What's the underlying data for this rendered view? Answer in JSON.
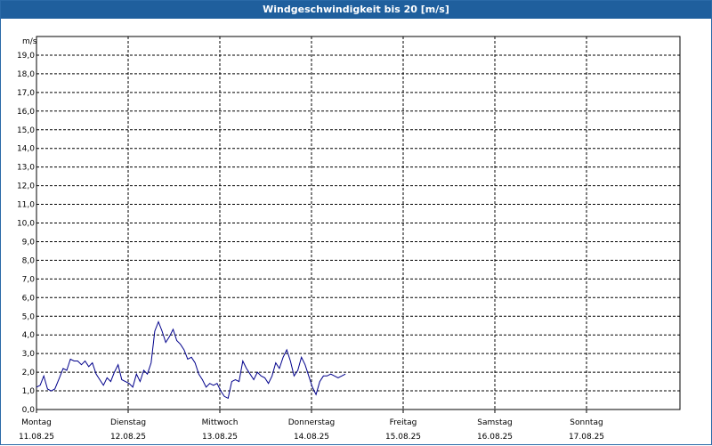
{
  "title": "Windgeschwindigkeit bis 20 [m/s]",
  "chart_data": {
    "type": "line",
    "title": "Windgeschwindigkeit bis 20 [m/s]",
    "ylabel": "m/s",
    "ylim": [
      0,
      20
    ],
    "y_ticks": [
      "0,0",
      "1,0",
      "2,0",
      "3,0",
      "4,0",
      "5,0",
      "6,0",
      "7,0",
      "8,0",
      "9,0",
      "10,0",
      "11,0",
      "12,0",
      "13,0",
      "14,0",
      "15,0",
      "16,0",
      "17,0",
      "18,0",
      "19,0"
    ],
    "x_categories": [
      {
        "day": "Montag",
        "date": "11.08.25"
      },
      {
        "day": "Dienstag",
        "date": "12.08.25"
      },
      {
        "day": "Mittwoch",
        "date": "13.08.25"
      },
      {
        "day": "Donnerstag",
        "date": "14.08.25"
      },
      {
        "day": "Freitag",
        "date": "15.08.25"
      },
      {
        "day": "Samstag",
        "date": "16.08.25"
      },
      {
        "day": "Sonntag",
        "date": "17.08.25"
      }
    ],
    "x_unit": "days since Montag 11.08.25 00:00",
    "xlim": [
      0,
      7
    ],
    "grid": true,
    "series": [
      {
        "name": "",
        "color": "#00008b",
        "x": [
          0.0,
          0.04,
          0.08,
          0.12,
          0.16,
          0.2,
          0.25,
          0.29,
          0.33,
          0.37,
          0.41,
          0.45,
          0.49,
          0.53,
          0.57,
          0.61,
          0.65,
          0.69,
          0.73,
          0.77,
          0.81,
          0.85,
          0.89,
          0.93,
          0.97,
          1.01,
          1.05,
          1.09,
          1.13,
          1.17,
          1.21,
          1.25,
          1.29,
          1.33,
          1.37,
          1.41,
          1.45,
          1.49,
          1.53,
          1.57,
          1.61,
          1.65,
          1.69,
          1.73,
          1.77,
          1.81,
          1.85,
          1.89,
          1.93,
          1.97,
          2.01,
          2.05,
          2.09,
          2.13,
          2.17,
          2.21,
          2.25,
          2.29,
          2.33,
          2.37,
          2.41,
          2.45,
          2.49,
          2.53,
          2.57,
          2.61,
          2.65,
          2.69,
          2.73,
          2.77,
          2.81,
          2.85,
          2.89,
          2.93,
          2.97,
          3.01,
          3.05,
          3.09,
          3.13,
          3.17,
          3.21,
          3.25,
          3.29,
          3.33,
          3.37
        ],
        "values": [
          1.2,
          1.3,
          1.8,
          1.1,
          1.0,
          1.1,
          1.7,
          2.2,
          2.1,
          2.7,
          2.6,
          2.6,
          2.4,
          2.6,
          2.3,
          2.5,
          1.9,
          1.6,
          1.3,
          1.7,
          1.5,
          2.0,
          2.4,
          1.6,
          1.5,
          1.4,
          1.2,
          1.9,
          1.5,
          2.1,
          1.9,
          2.5,
          4.2,
          4.7,
          4.2,
          3.6,
          3.9,
          4.3,
          3.7,
          3.5,
          3.2,
          2.7,
          2.8,
          2.5,
          1.9,
          1.6,
          1.2,
          1.4,
          1.3,
          1.4,
          1.0,
          0.7,
          0.6,
          1.5,
          1.6,
          1.5,
          2.6,
          2.2,
          1.9,
          1.6,
          2.0,
          1.8,
          1.7,
          1.4,
          1.8,
          2.5,
          2.2,
          2.8,
          3.2,
          2.6,
          1.8,
          2.1,
          2.8,
          2.4,
          1.8,
          1.2,
          0.8,
          1.5,
          1.8,
          1.8,
          1.9,
          1.8,
          1.7,
          1.8,
          1.9
        ]
      }
    ]
  }
}
